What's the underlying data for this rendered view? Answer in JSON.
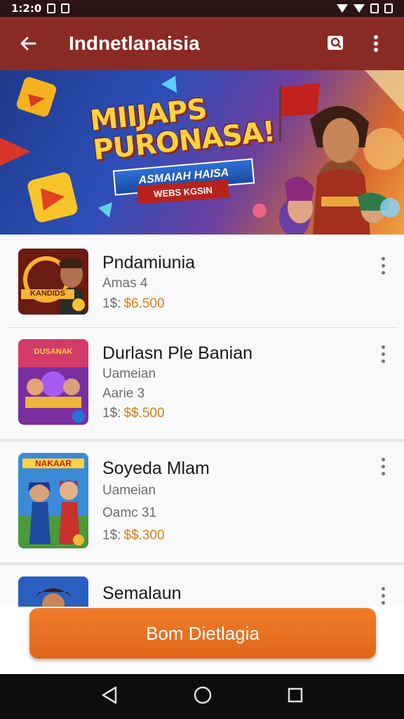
{
  "status_bar": {
    "time": "1:2:0"
  },
  "app_bar": {
    "title": "Indnetlanaisia"
  },
  "banner": {
    "headline": "MIIJAPS PURONASA!",
    "ribbon_top": "ASMAIAH HAISA",
    "ribbon_bottom": "WEBS KGSIN"
  },
  "items": [
    {
      "title": "Pndamiunia",
      "subtitle": "Amas 4",
      "price_label": "1$:",
      "price": "$6.500",
      "thumb_text": "KANDIDS"
    },
    {
      "title": "Durlasn Ple Banian",
      "subtitle": "Uameian",
      "subtitle2": "Aarie 3",
      "price_label": "1$:",
      "price": "$$.500",
      "thumb_text": "DUSANAK"
    },
    {
      "title": "Soyeda Mlam",
      "subtitle": "Uameian",
      "subtitle2": "Oamc 31",
      "price_label": "1$:",
      "price": "$$.300",
      "thumb_text": "NAKAAR"
    },
    {
      "title": "Semalaun"
    }
  ],
  "cta": {
    "label": "Bom Dietlagia"
  },
  "colors": {
    "app_bar": "#8a2a24",
    "accent": "#e07a1a",
    "cta": "#f07c2a"
  }
}
